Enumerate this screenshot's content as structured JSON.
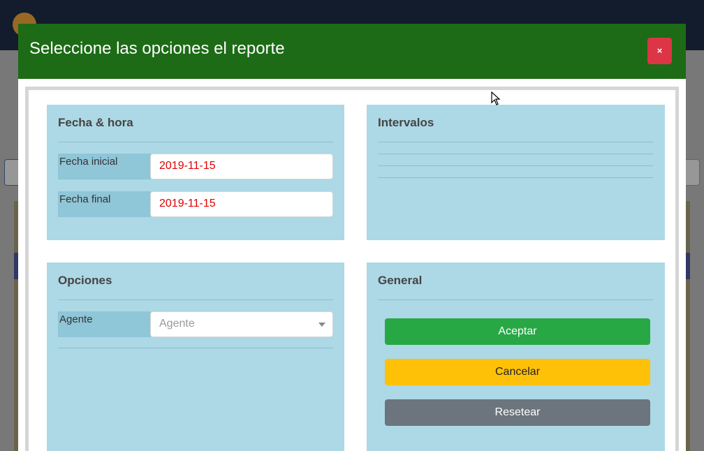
{
  "modal": {
    "title": "Seleccione las opciones el reporte",
    "close_label": "×"
  },
  "datetime_card": {
    "title": "Fecha & hora",
    "start": {
      "label": "Fecha inicial",
      "value": "2019-11-15"
    },
    "end": {
      "label": "Fecha final",
      "value": "2019-11-15"
    }
  },
  "intervals_card": {
    "title": "Intervalos"
  },
  "options_card": {
    "title": "Opciones",
    "agent": {
      "label": "Agente",
      "placeholder": "Agente"
    }
  },
  "general_card": {
    "title": "General",
    "accept_label": "Aceptar",
    "cancel_label": "Cancelar",
    "reset_label": "Resetear"
  },
  "colors": {
    "header": "#1d6b16",
    "card": "#add8e6",
    "accept": "#28a745",
    "cancel": "#ffc107",
    "reset": "#6c757d",
    "close": "#dc3545",
    "date_text": "#e00000"
  }
}
